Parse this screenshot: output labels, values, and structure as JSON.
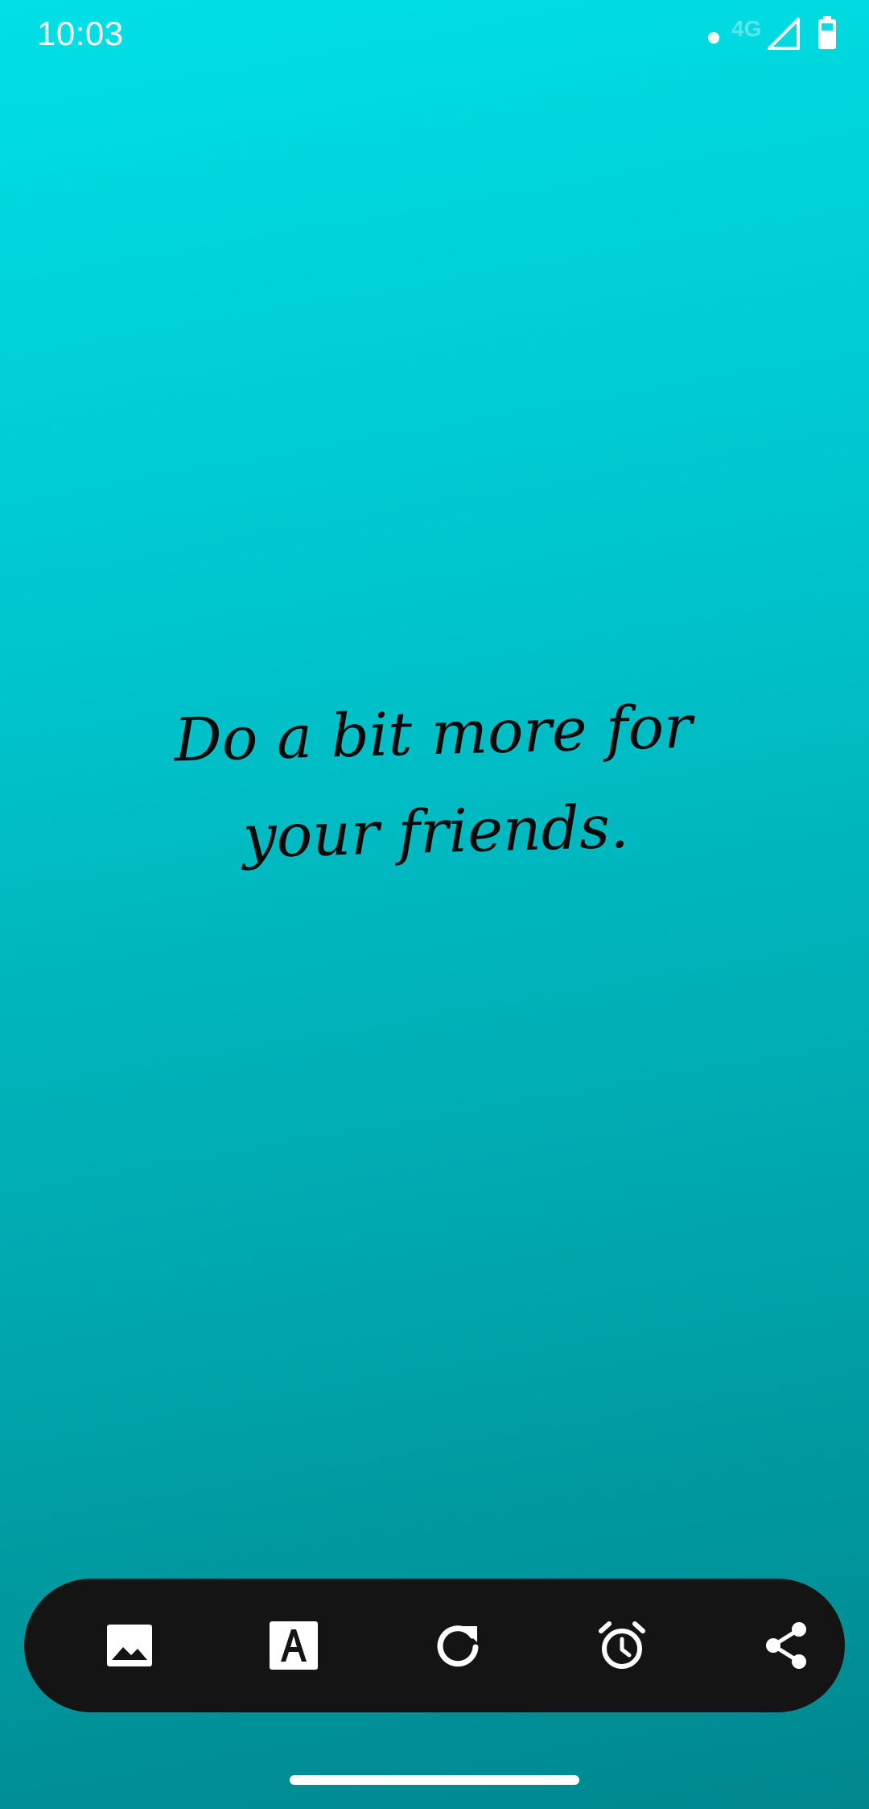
{
  "status_bar": {
    "time": "10:03",
    "network": "4G",
    "icons": [
      "notification-dot-icon",
      "signal-icon",
      "battery-icon"
    ]
  },
  "quote": {
    "text": "Do a bit more for your friends."
  },
  "toolbar": {
    "buttons": [
      {
        "icon": "image-icon"
      },
      {
        "icon": "font-icon"
      },
      {
        "icon": "refresh-icon"
      },
      {
        "icon": "alarm-icon"
      },
      {
        "icon": "share-icon"
      }
    ]
  },
  "colors": {
    "background_top": "#00e0e6",
    "background_bottom": "#00878e",
    "toolbar": "#141414",
    "icon": "#ffffff",
    "quote_text": "#0a0a0a"
  }
}
